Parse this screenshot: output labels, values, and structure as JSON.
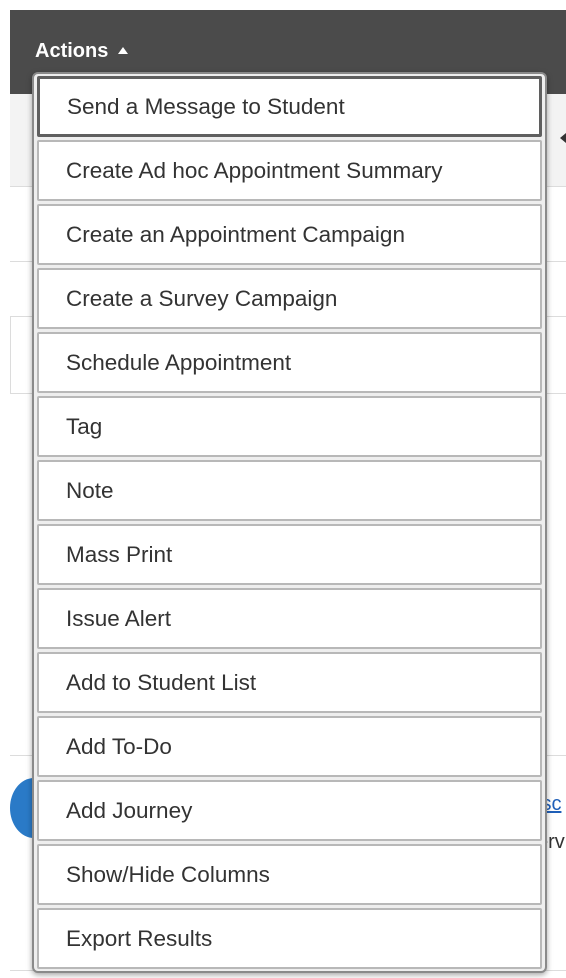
{
  "header": {
    "actions_label": "Actions"
  },
  "background": {
    "link_fragment": "isc",
    "text_fragment": "erv"
  },
  "menu": {
    "items": [
      {
        "label": "Send a Message to Student"
      },
      {
        "label": "Create Ad hoc Appointment Summary"
      },
      {
        "label": "Create an Appointment Campaign"
      },
      {
        "label": "Create a Survey Campaign"
      },
      {
        "label": "Schedule Appointment"
      },
      {
        "label": "Tag"
      },
      {
        "label": "Note"
      },
      {
        "label": "Mass Print"
      },
      {
        "label": "Issue Alert"
      },
      {
        "label": "Add to Student List"
      },
      {
        "label": "Add To-Do"
      },
      {
        "label": "Add Journey"
      },
      {
        "label": "Show/Hide Columns"
      },
      {
        "label": "Export Results"
      }
    ]
  },
  "icons": {
    "actions_caret": "caret-up-icon",
    "info": "info-icon",
    "sort": "sort-arrow-icon"
  },
  "colors": {
    "header_bg": "#4b4b4b",
    "menu_item_text": "#333333",
    "link": "#1f5fb8",
    "info_icon": "#2a7ac7"
  }
}
